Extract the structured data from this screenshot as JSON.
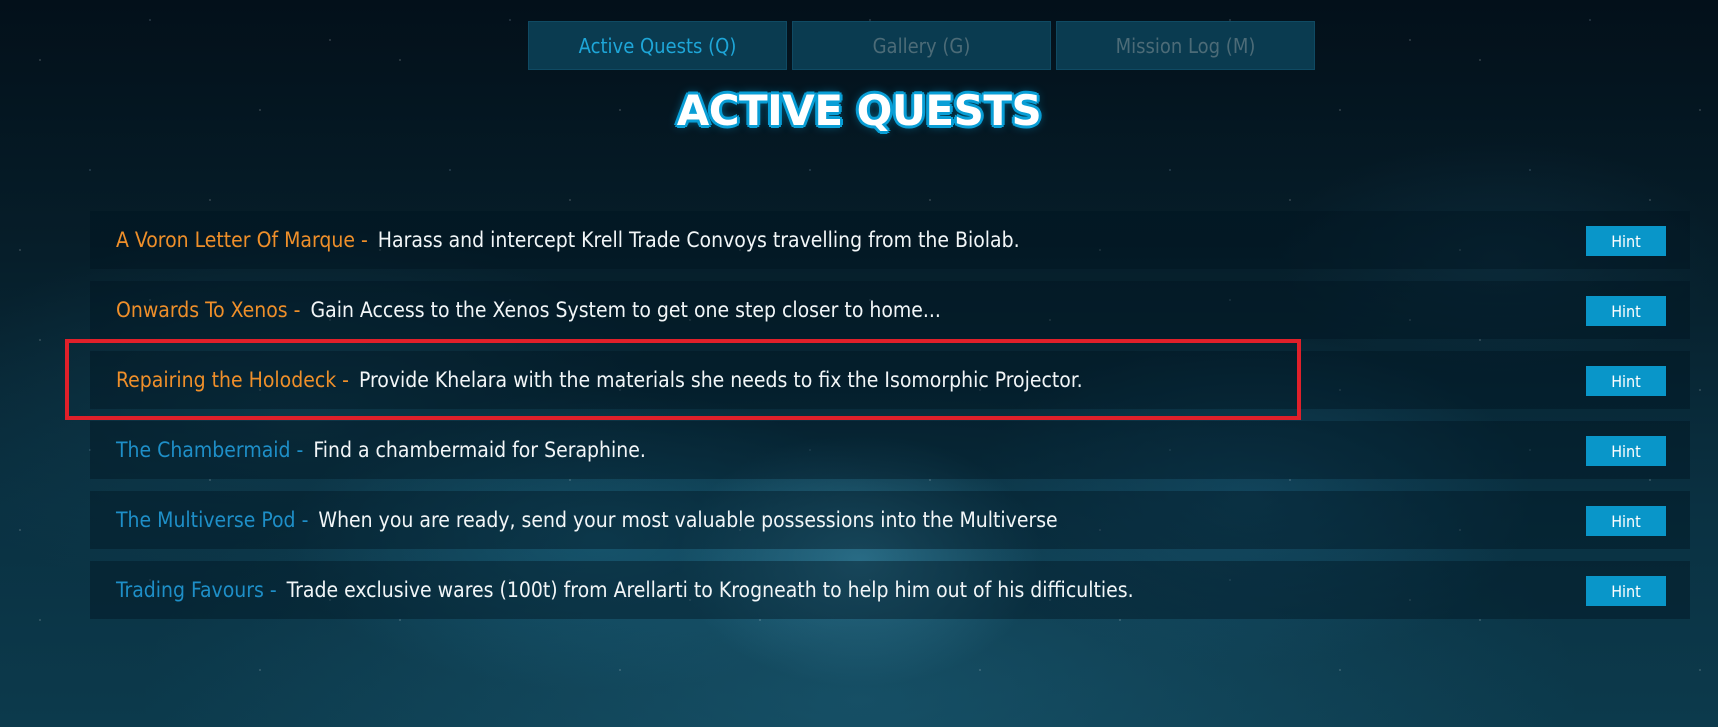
{
  "tabs": [
    {
      "label": "Active Quests (Q)",
      "active": true
    },
    {
      "label": "Gallery (G)",
      "active": false
    },
    {
      "label": "Mission Log (M)",
      "active": false
    }
  ],
  "title": "ACTIVE QUESTS",
  "separator": "-",
  "hint_label": "Hint",
  "quests": [
    {
      "name": "A Voron Letter Of Marque",
      "description": "Harass and intercept Krell Trade Convoys travelling from the Biolab.",
      "color": "orange"
    },
    {
      "name": "Onwards To Xenos",
      "description": "Gain Access to the Xenos System to get one step closer to home...",
      "color": "orange"
    },
    {
      "name": "Repairing the Holodeck",
      "description": "Provide Khelara with the materials she needs to fix the Isomorphic Projector.",
      "color": "orange"
    },
    {
      "name": "The Chambermaid",
      "description": "Find a chambermaid for Seraphine.",
      "color": "blue"
    },
    {
      "name": "The Multiverse Pod",
      "description": "When you are ready, send your most valuable possessions into the Multiverse",
      "color": "blue"
    },
    {
      "name": "Trading Favours",
      "description": "Trade exclusive wares (100t) from Arellarti to Krogneath to help him out of his difficulties.",
      "color": "blue"
    }
  ],
  "colors": {
    "quest_orange": "#ef8f2a",
    "quest_blue": "#1e8fc8",
    "hint_button": "#0996c9",
    "highlight": "#e0202a",
    "tab_active_text": "#1ea6d8",
    "tab_inactive_text": "#4c6b77"
  }
}
